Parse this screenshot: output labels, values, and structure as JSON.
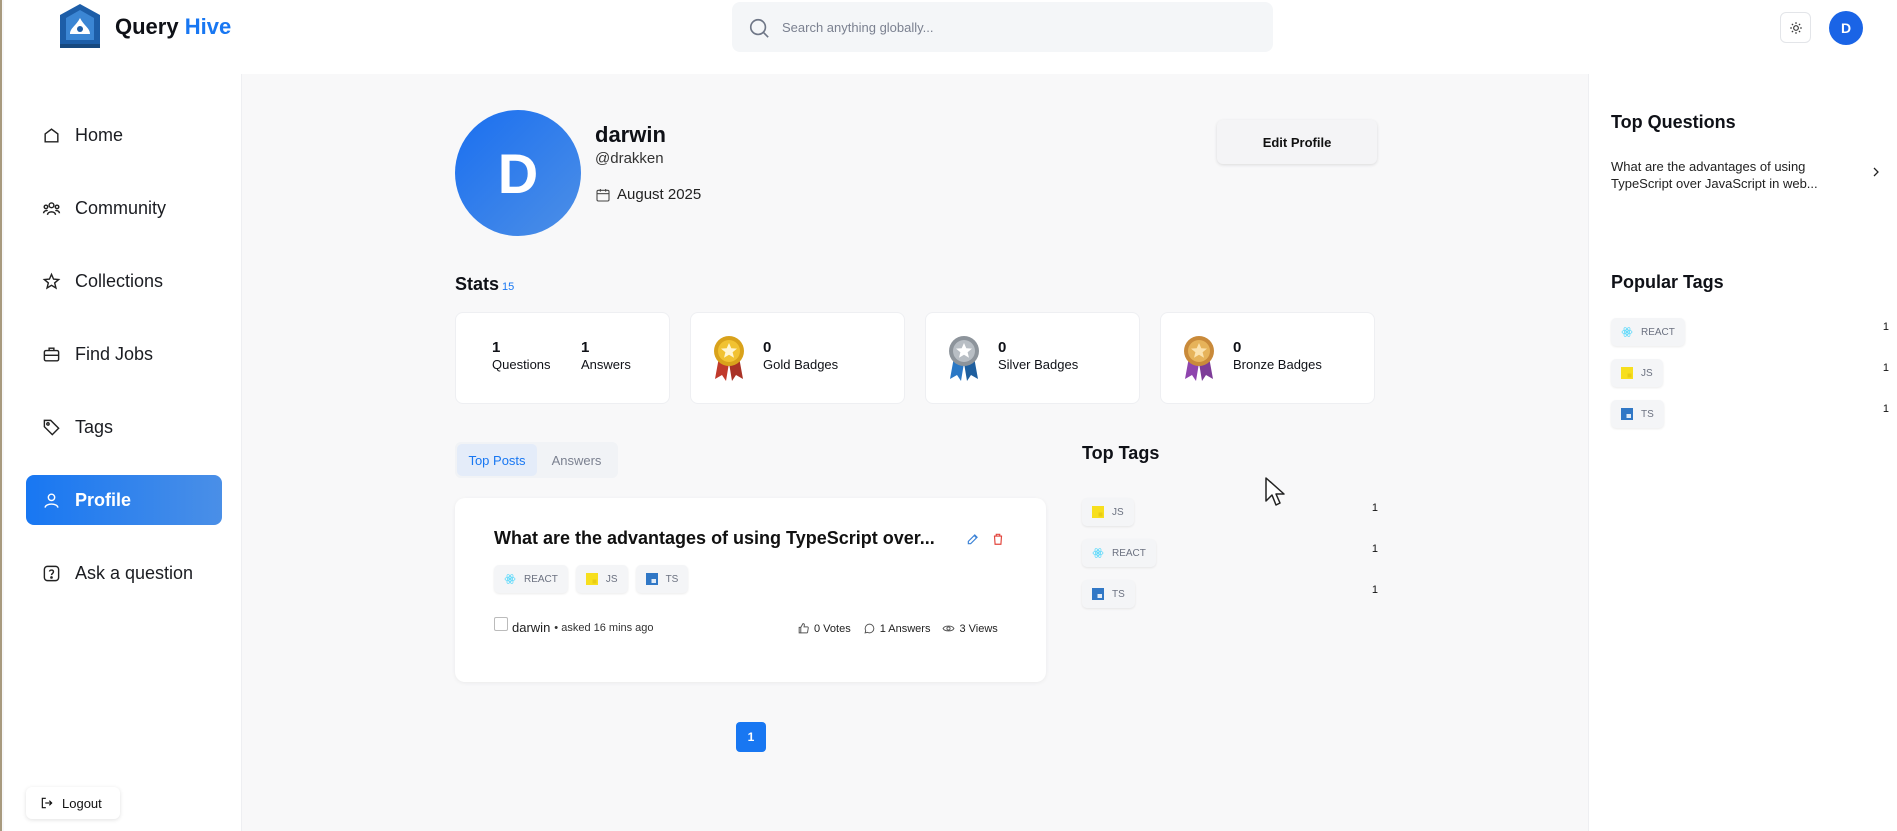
{
  "brand": {
    "name_part1": "Query",
    "name_part2": "Hive"
  },
  "search": {
    "placeholder": "Search anything globally..."
  },
  "header": {
    "user_initial": "D"
  },
  "sidebar": {
    "items": [
      {
        "label": "Home",
        "icon": "home-icon"
      },
      {
        "label": "Community",
        "icon": "users-icon"
      },
      {
        "label": "Collections",
        "icon": "star-icon"
      },
      {
        "label": "Find Jobs",
        "icon": "briefcase-icon"
      },
      {
        "label": "Tags",
        "icon": "tag-icon"
      },
      {
        "label": "Profile",
        "icon": "user-icon",
        "active": true
      },
      {
        "label": "Ask a question",
        "icon": "question-icon"
      }
    ],
    "logout": "Logout"
  },
  "profile": {
    "initial": "D",
    "name": "darwin",
    "username": "@drakken",
    "joined": "August 2025",
    "edit_label": "Edit Profile"
  },
  "stats": {
    "title": "Stats",
    "total": "15",
    "questions_count": "1",
    "questions_label": "Questions",
    "answers_count": "1",
    "answers_label": "Answers",
    "gold_count": "0",
    "gold_label": "Gold Badges",
    "silver_count": "0",
    "silver_label": "Silver Badges",
    "bronze_count": "0",
    "bronze_label": "Bronze Badges"
  },
  "tabs": {
    "top_posts": "Top Posts",
    "answers": "Answers"
  },
  "post": {
    "title": "What are the advantages of using TypeScript over...",
    "tags": [
      "REACT",
      "JS",
      "TS"
    ],
    "author": "darwin",
    "asked": "• asked 16 mins ago",
    "votes": "0 Votes",
    "answers": "1 Answers",
    "views": "3 Views"
  },
  "pagination": {
    "current": "1"
  },
  "top_tags": {
    "title": "Top Tags",
    "items": [
      {
        "name": "JS",
        "count": "1"
      },
      {
        "name": "REACT",
        "count": "1"
      },
      {
        "name": "TS",
        "count": "1"
      }
    ]
  },
  "right_sidebar": {
    "top_questions_title": "Top Questions",
    "question": "What are the advantages of using TypeScript over JavaScript in web...",
    "popular_tags_title": "Popular Tags",
    "popular_tags": [
      {
        "name": "REACT",
        "count": "1"
      },
      {
        "name": "JS",
        "count": "1"
      },
      {
        "name": "TS",
        "count": "1"
      }
    ]
  },
  "colors": {
    "accent": "#1877f2",
    "gold": "#d9a21b",
    "silver": "#9aa0a6",
    "bronze": "#c98a3a"
  }
}
